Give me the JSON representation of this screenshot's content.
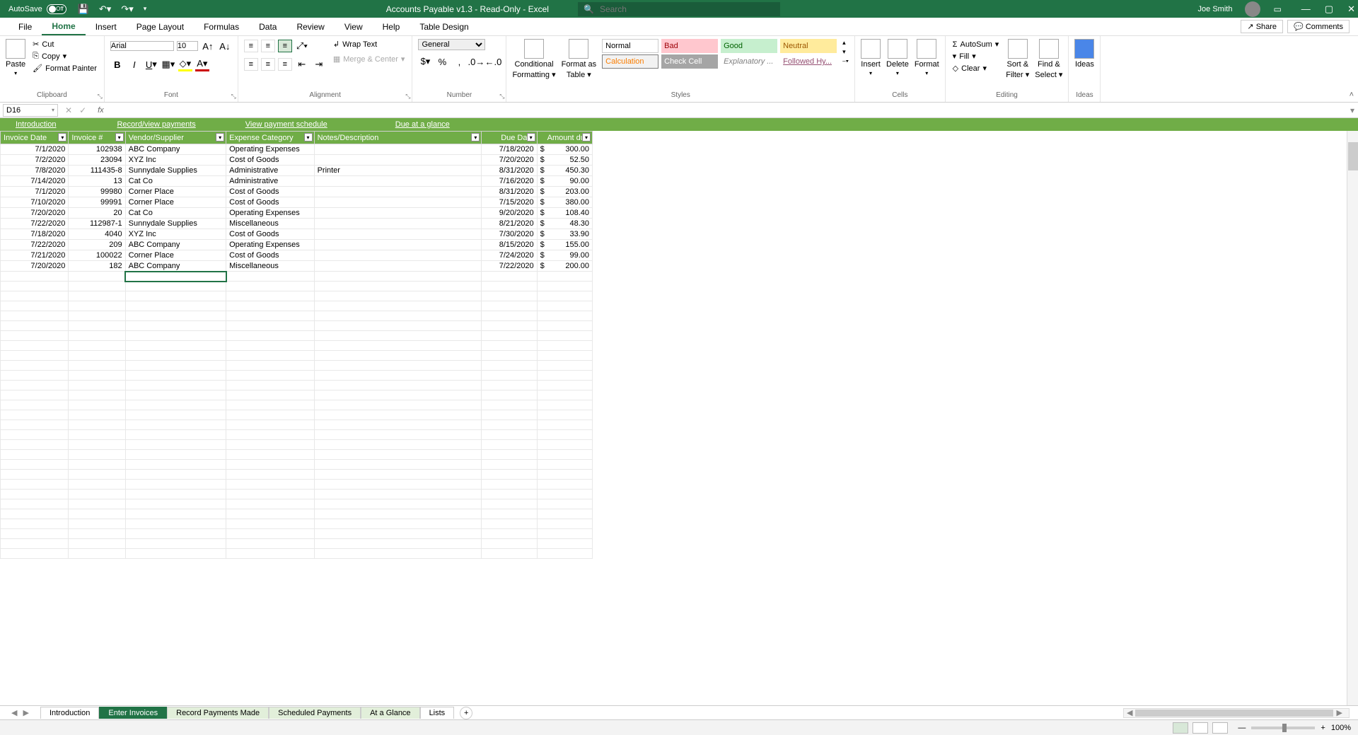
{
  "title_bar": {
    "autosave_label": "AutoSave",
    "autosave_state": "Off",
    "doc_title": "Accounts Payable v1.3  -  Read-Only  -  Excel",
    "search_placeholder": "Search",
    "user_name": "Joe Smith"
  },
  "ribbon_tabs": {
    "tabs": [
      "File",
      "Home",
      "Insert",
      "Page Layout",
      "Formulas",
      "Data",
      "Review",
      "View",
      "Help",
      "Table Design"
    ],
    "active": "Home",
    "share": "Share",
    "comments": "Comments"
  },
  "ribbon": {
    "clipboard": {
      "paste": "Paste",
      "cut": "Cut",
      "copy": "Copy",
      "format_painter": "Format Painter",
      "label": "Clipboard"
    },
    "font": {
      "font_name": "Arial",
      "font_size": "10",
      "label": "Font"
    },
    "alignment": {
      "wrap": "Wrap Text",
      "merge": "Merge & Center",
      "label": "Alignment"
    },
    "number": {
      "format": "General",
      "label": "Number"
    },
    "styles": {
      "cond": "Conditional Formatting",
      "cond1": "Conditional",
      "cond2": "Formatting",
      "fat1": "Format as",
      "fat2": "Table",
      "normal": "Normal",
      "bad": "Bad",
      "good": "Good",
      "neutral": "Neutral",
      "calculation": "Calculation",
      "check": "Check Cell",
      "explanatory": "Explanatory ...",
      "followed": "Followed Hy...",
      "label": "Styles"
    },
    "cells": {
      "insert": "Insert",
      "delete": "Delete",
      "format": "Format",
      "label": "Cells"
    },
    "editing": {
      "autosum": "AutoSum",
      "fill": "Fill",
      "clear": "Clear",
      "sort": "Sort & Filter",
      "sort1": "Sort &",
      "sort2": "Filter",
      "find1": "Find &",
      "find2": "Select",
      "label": "Editing"
    },
    "ideas": {
      "ideas": "Ideas",
      "label": "Ideas"
    }
  },
  "formula_bar": {
    "name_box": "D16",
    "fx": "fx",
    "value": ""
  },
  "nav_links": {
    "intro": "Introduction",
    "record": "Record/view payments",
    "schedule": "View payment schedule",
    "due": "Due at a glance"
  },
  "table": {
    "headers": [
      "Invoice Date",
      "Invoice #",
      "Vendor/Supplier",
      "Expense Category",
      "Notes/Description",
      "Due Date",
      "Amount due"
    ],
    "rows": [
      {
        "date": "7/1/2020",
        "inv": "102938",
        "vendor": "ABC Company",
        "cat": "Operating Expenses",
        "notes": "",
        "due": "7/18/2020",
        "amt": "300.00"
      },
      {
        "date": "7/2/2020",
        "inv": "23094",
        "vendor": "XYZ Inc",
        "cat": "Cost of Goods",
        "notes": "",
        "due": "7/20/2020",
        "amt": "52.50"
      },
      {
        "date": "7/8/2020",
        "inv": "111435-8",
        "vendor": "Sunnydale Supplies",
        "cat": "Administrative",
        "notes": "Printer",
        "due": "8/31/2020",
        "amt": "450.30"
      },
      {
        "date": "7/14/2020",
        "inv": "13",
        "vendor": "Cat Co",
        "cat": "Administrative",
        "notes": "",
        "due": "7/16/2020",
        "amt": "90.00"
      },
      {
        "date": "7/1/2020",
        "inv": "99980",
        "vendor": "Corner Place",
        "cat": "Cost of Goods",
        "notes": "",
        "due": "8/31/2020",
        "amt": "203.00"
      },
      {
        "date": "7/10/2020",
        "inv": "99991",
        "vendor": "Corner Place",
        "cat": "Cost of Goods",
        "notes": "",
        "due": "7/15/2020",
        "amt": "380.00"
      },
      {
        "date": "7/20/2020",
        "inv": "20",
        "vendor": "Cat Co",
        "cat": "Operating Expenses",
        "notes": "",
        "due": "9/20/2020",
        "amt": "108.40"
      },
      {
        "date": "7/22/2020",
        "inv": "112987-1",
        "vendor": "Sunnydale Supplies",
        "cat": "Miscellaneous",
        "notes": "",
        "due": "8/21/2020",
        "amt": "48.30"
      },
      {
        "date": "7/18/2020",
        "inv": "4040",
        "vendor": "XYZ Inc",
        "cat": "Cost of Goods",
        "notes": "",
        "due": "7/30/2020",
        "amt": "33.90"
      },
      {
        "date": "7/22/2020",
        "inv": "209",
        "vendor": "ABC Company",
        "cat": "Operating Expenses",
        "notes": "",
        "due": "8/15/2020",
        "amt": "155.00"
      },
      {
        "date": "7/21/2020",
        "inv": "100022",
        "vendor": "Corner Place",
        "cat": "Cost of Goods",
        "notes": "",
        "due": "7/24/2020",
        "amt": "99.00"
      },
      {
        "date": "7/20/2020",
        "inv": "182",
        "vendor": "ABC Company",
        "cat": "Miscellaneous",
        "notes": "",
        "due": "7/22/2020",
        "amt": "200.00"
      }
    ],
    "currency": "$"
  },
  "sheet_tabs": {
    "tabs": [
      "Introduction",
      "Enter Invoices",
      "Record Payments Made",
      "Scheduled Payments",
      "At a Glance",
      "Lists"
    ],
    "active": "Enter Invoices"
  },
  "status_bar": {
    "zoom": "100%"
  }
}
